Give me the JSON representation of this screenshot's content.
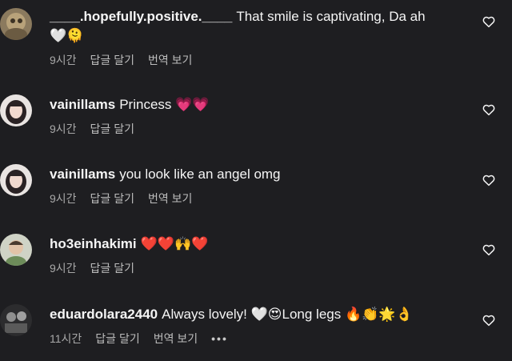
{
  "comments": [
    {
      "username": "____.hopefully.positive.____",
      "text": "That smile is captivating, Da ah",
      "emoji_line": "🤍🫠",
      "time": "9시간",
      "reply": "답글 달기",
      "translate": "번역 보기"
    },
    {
      "username": "vainillams",
      "text": "Princess 💗💗",
      "time": "9시간",
      "reply": "답글 달기"
    },
    {
      "username": "vainillams",
      "text": "you look like an angel omg",
      "time": "9시간",
      "reply": "답글 달기",
      "translate": "번역 보기"
    },
    {
      "username": "ho3einhakimi",
      "text": "❤️❤️🙌❤️",
      "time": "9시간",
      "reply": "답글 달기"
    },
    {
      "username": "eduardolara2440",
      "text": "Always lovely! 🤍😍Long legs 🔥👏🌟👌",
      "time": "11시간",
      "reply": "답글 달기",
      "translate": "번역 보기",
      "more": "•••"
    }
  ],
  "icons": {
    "like": "heart-outline-icon"
  },
  "colors": {
    "background": "#1e1e21",
    "text_primary": "#f5f5f5",
    "text_secondary": "#a8a8a8"
  }
}
